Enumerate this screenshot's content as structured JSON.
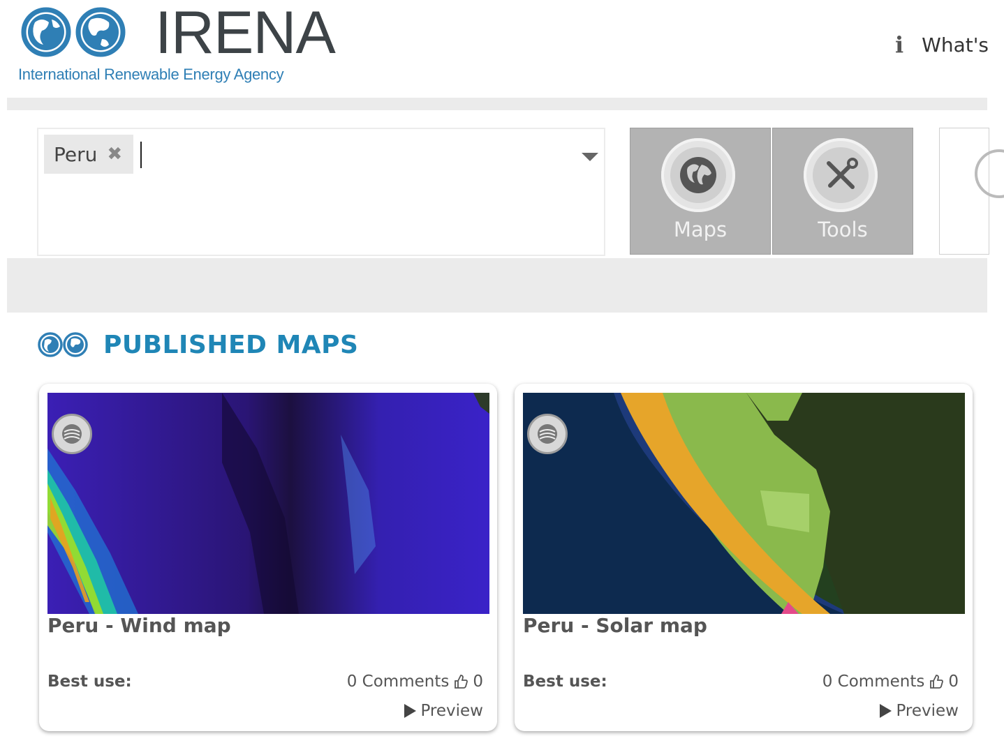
{
  "header": {
    "logo_name": "IRENA",
    "logo_subtitle": "International Renewable Energy Agency",
    "info_icon": "info-icon",
    "info_text": "What's"
  },
  "search": {
    "tags": [
      {
        "label": "Peru",
        "remove_icon": "close-icon"
      }
    ],
    "value": "",
    "dropdown_icon": "chevron-down-icon"
  },
  "categories": [
    {
      "label": "Maps",
      "icon": "globe-icon"
    },
    {
      "label": "Tools",
      "icon": "tools-icon"
    }
  ],
  "section": {
    "title": "PUBLISHED MAPS",
    "icon": "globe-pair-icon"
  },
  "cards": [
    {
      "title": "Peru - Wind map",
      "best_use_label": "Best use:",
      "comments": "0 Comments",
      "likes": "0",
      "preview": "Preview"
    },
    {
      "title": "Peru - Solar map",
      "best_use_label": "Best use:",
      "comments": "0 Comments",
      "likes": "0",
      "preview": "Preview"
    }
  ],
  "colors": {
    "brand_blue": "#1f86b6",
    "button_gray": "#b3b3b3",
    "band_gray": "#ebebeb"
  }
}
